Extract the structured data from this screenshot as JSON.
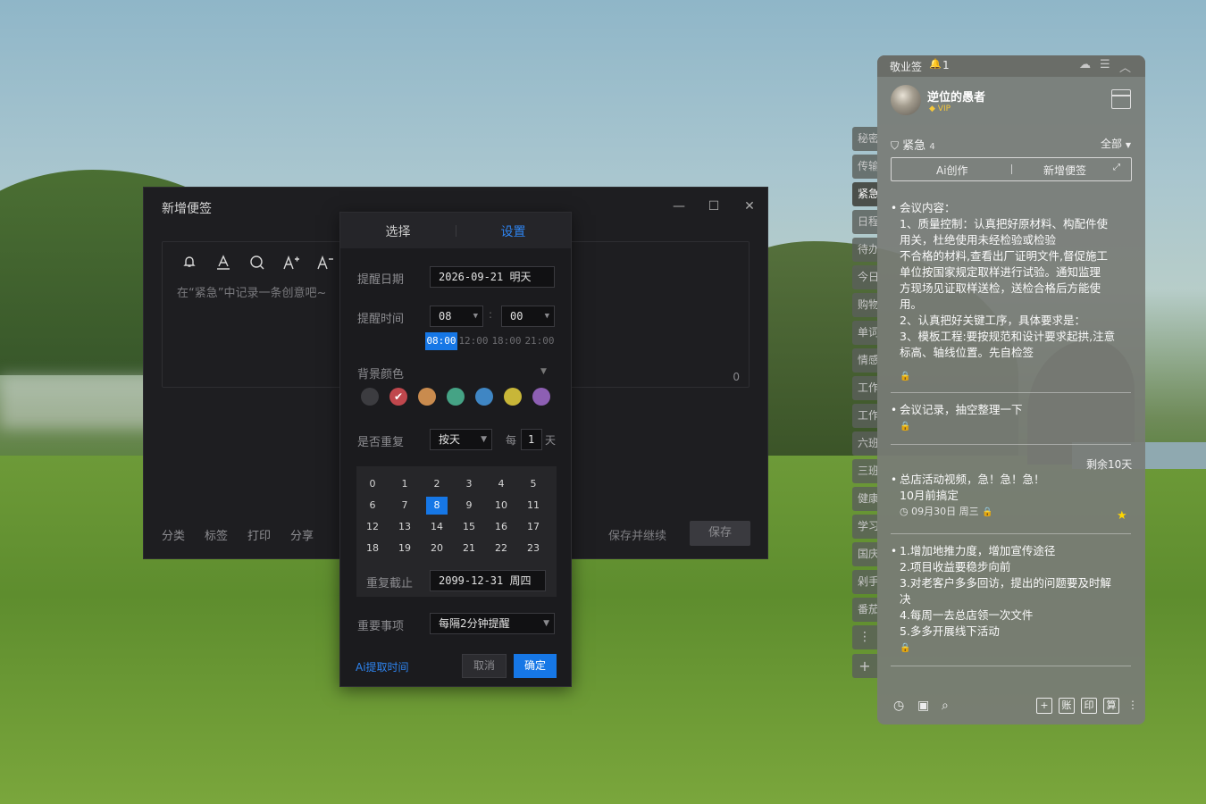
{
  "note_window": {
    "title": "新增便签",
    "controls": [
      "—",
      "☐",
      "✕"
    ],
    "placeholder": "在“紧急”中记录一条创意吧~",
    "char_count": "0",
    "footer_links": [
      "分类",
      "标签",
      "打印",
      "分享"
    ],
    "save_continue": "保存并继续",
    "save": "保存"
  },
  "reminder": {
    "tabs": [
      "选择",
      "设置"
    ],
    "active_tab": "设置",
    "date_label": "提醒日期",
    "date_value": "2026-09-21 明天",
    "time_label": "提醒时间",
    "hour_value": "08",
    "minute_value": "00",
    "time_sep": ":",
    "quick_times": [
      "08:00",
      "12:00",
      "18:00",
      "21:00"
    ],
    "bg_color_label": "背景颜色",
    "colors": [
      "#3c3c40",
      "#c0474d",
      "#c98b4e",
      "#45a385",
      "#3f86c4",
      "#c8b638",
      "#8d5fb3"
    ],
    "repeat_label": "是否重复",
    "repeat_value": "按天",
    "every_label": "每",
    "every_value": "1",
    "every_unit": "天",
    "hours": [
      "0",
      "1",
      "2",
      "3",
      "4",
      "5",
      "6",
      "7",
      "8",
      "9",
      "10",
      "11",
      "12",
      "13",
      "14",
      "15",
      "16",
      "17",
      "18",
      "19",
      "20",
      "21",
      "22",
      "23"
    ],
    "selected_hour": "8",
    "repeat_end_label": "重复截止",
    "repeat_end_value": "2099-12-31 周四",
    "important_label": "重要事项",
    "important_value": "每隔2分钟提醒",
    "ai_extract": "Ai提取时间",
    "cancel": "取消",
    "ok": "确定"
  },
  "side_tabs": [
    "秘密",
    "传输",
    "紧急",
    "日程",
    "待办",
    "今日",
    "购物",
    "单词",
    "情感",
    "工作",
    "工作",
    "六班",
    "三班",
    "健康",
    "学习",
    "国庆",
    "剁手",
    "番茄"
  ],
  "active_side_tab": "紧急",
  "side_more": "⋮",
  "side_add": "+",
  "panel": {
    "app_name": "敬业签",
    "bell_count": "1",
    "user_name": "逆位的愚者",
    "vip": "VIP",
    "category": "紧急",
    "category_count": "4",
    "filter": "全部",
    "ai_create": "Ai创作",
    "new_note": "新增便签",
    "notes": [
      {
        "lines": [
          "会议内容：",
          "1、质量控制：认真把好原材料、构配件使",
          "用关，杜绝使用未经检验或检验",
          "不合格的材料,查看出厂证明文件,督促施工",
          "单位按国家规定取样进行试验。通知监理",
          "方现场见证取样送检，送检合格后方能使",
          "用。",
          "2、认真把好关键工序，具体要求是：",
          "3、模板工程:要按规范和设计要求起拱,注意",
          "标高、轴线位置。先自检签"
        ]
      },
      {
        "lines": [
          "会议记录，抽空整理一下"
        ]
      },
      {
        "remaining": "剩余10天",
        "lines": [
          "总店活动视频，急！急！急！",
          "10月前搞定"
        ],
        "meta": "09月30日 周三"
      },
      {
        "lines": [
          "1.增加地推力度，增加宣传途径",
          "2.项目收益要稳步向前",
          "3.对老客户多多回访，提出的问题要及时解",
          "决",
          "4.每周一去总店领一次文件",
          "5.多多开展线下活动"
        ]
      }
    ],
    "footer_boxes": [
      "+",
      "账",
      "印",
      "算"
    ]
  }
}
